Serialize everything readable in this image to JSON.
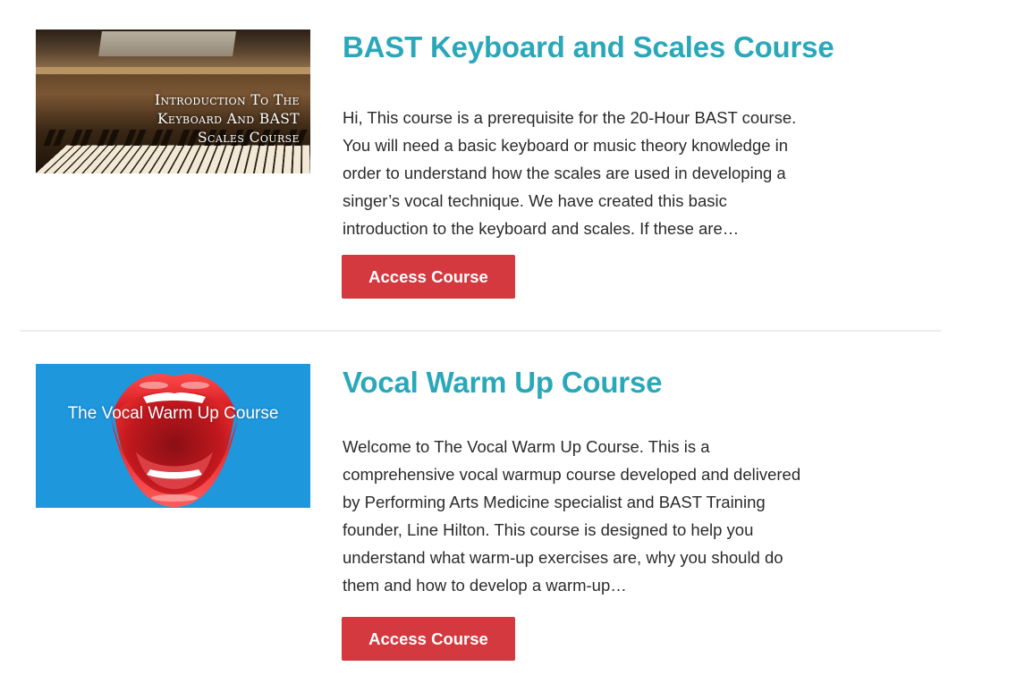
{
  "courses": [
    {
      "title": "BAST Keyboard and Scales Course",
      "thumbnail": {
        "text_lines": [
          "Introduction To The",
          "Keyboard And BAST",
          "Scales Course"
        ],
        "description": "piano keyboard photo with overlay text"
      },
      "description_lines": [
        "Hi, This course is a prerequisite for the 20-Hour BAST course.",
        "You will need a basic keyboard or music theory knowledge in",
        "order to understand how the scales are used in developing a",
        "singer’s vocal technique. We have created this basic",
        "introduction to the keyboard and scales. If these are…"
      ],
      "button_label": "Access Course"
    },
    {
      "title": "Vocal Warm Up Course",
      "thumbnail": {
        "text": "The Vocal Warm Up Course",
        "background_color": "#1e97dc"
      },
      "description_lines": [
        "Welcome to The Vocal Warm Up Course. This is a",
        "comprehensive vocal warmup course developed and delivered",
        "by Performing Arts Medicine specialist and BAST Training",
        "founder, Line Hilton. This course is designed to help you",
        "understand what warm-up exercises are, why you should do",
        "them and how to develop a warm-up…"
      ],
      "button_label": "Access Course"
    }
  ],
  "colors": {
    "title": "#2aa8b9",
    "button": "#d3393f",
    "text": "#2b2b2b",
    "divider": "#ececec"
  }
}
